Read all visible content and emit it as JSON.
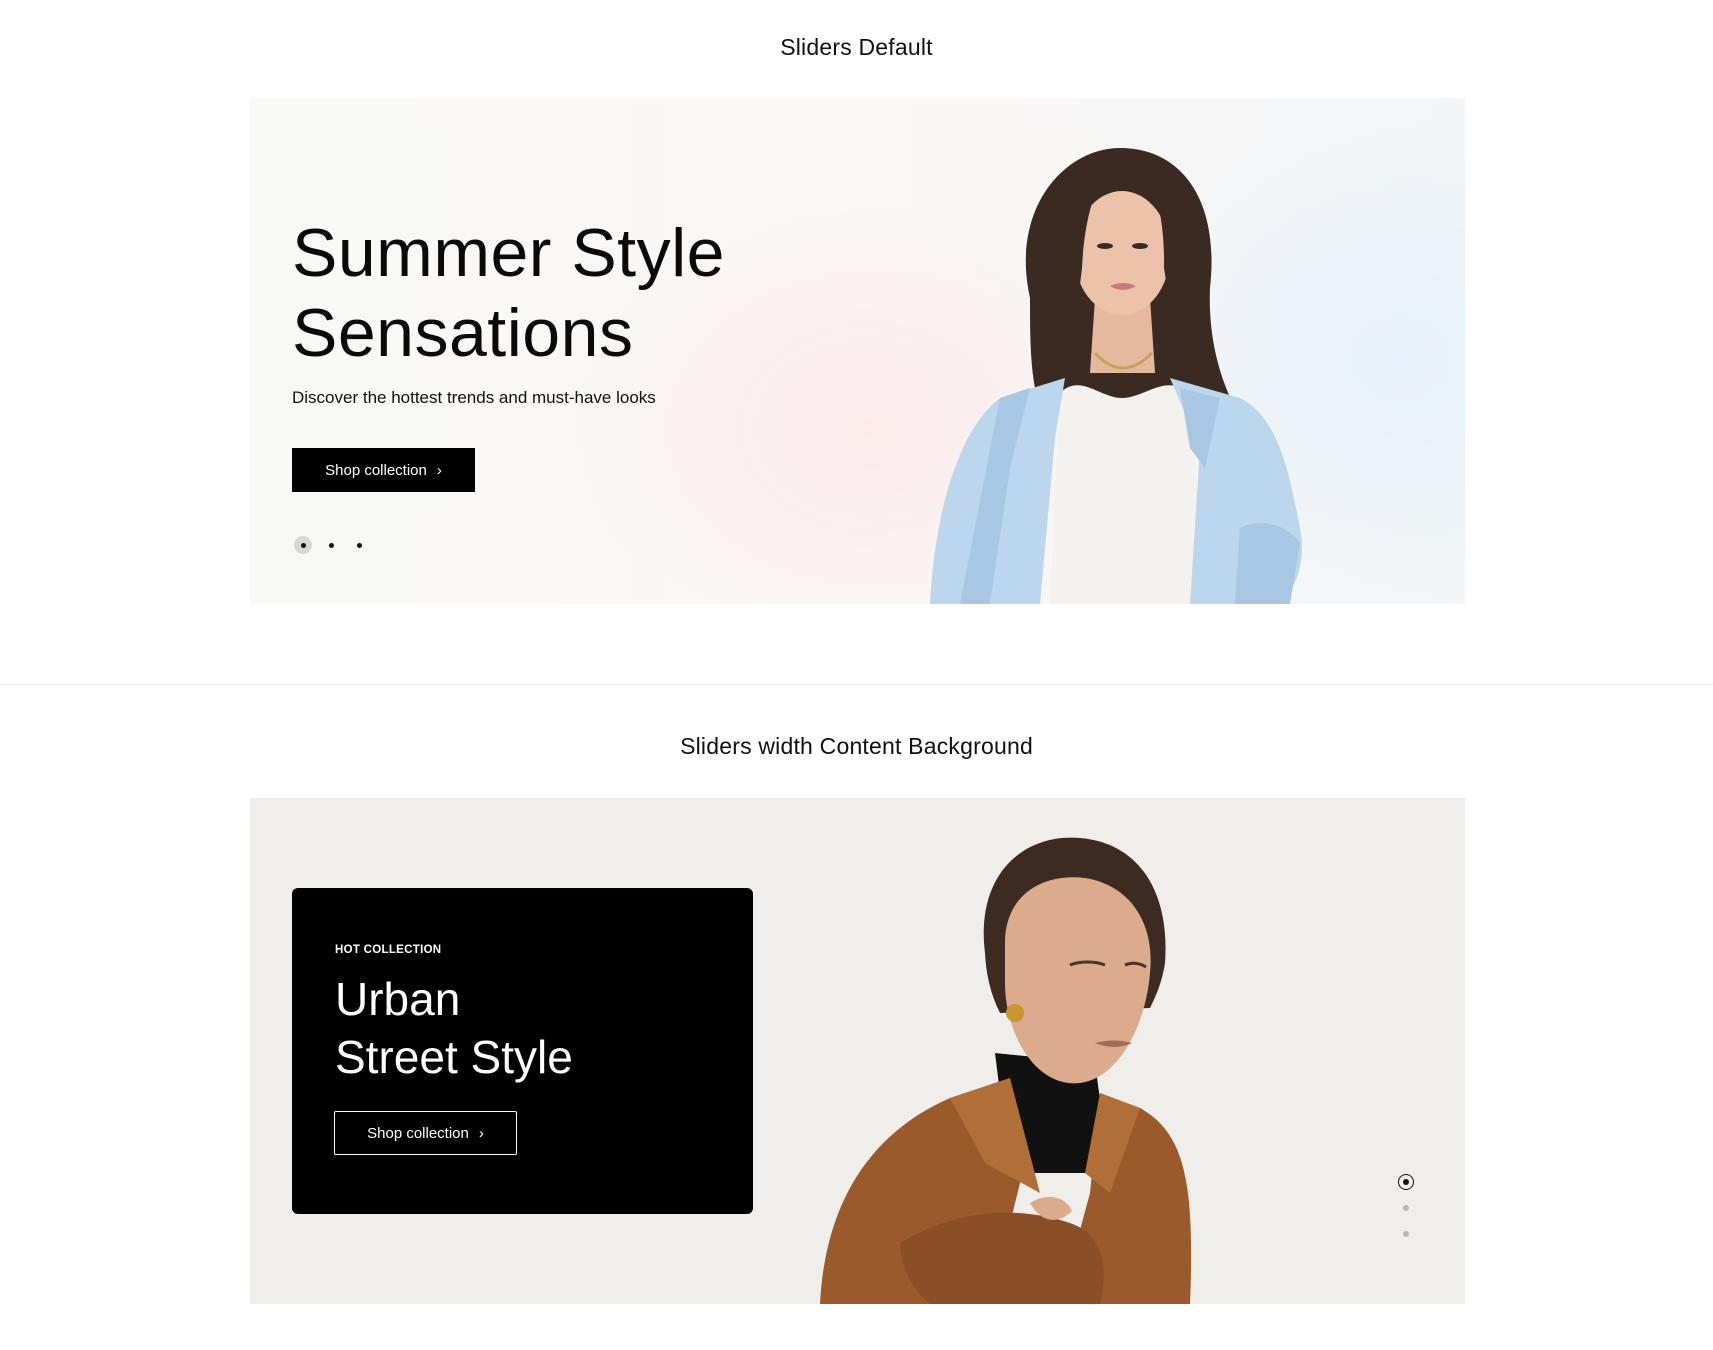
{
  "sections": [
    {
      "title": "Sliders Default",
      "slide": {
        "heading_line1": "Summer Style",
        "heading_line2": "Sensations",
        "subtitle": "Discover the hottest trends and must-have looks",
        "button_label": "Shop collection",
        "button_icon": "chevron-right-icon",
        "pagination": {
          "count": 3,
          "active_index": 0
        }
      }
    },
    {
      "title": "Sliders width Content Background",
      "slide": {
        "tag": "HOT COLLECTION",
        "heading_line1": "Urban",
        "heading_line2": "Street Style",
        "button_label": "Shop collection",
        "button_icon": "chevron-right-icon",
        "pagination": {
          "count": 3,
          "active_index": 0
        }
      }
    }
  ],
  "colors": {
    "button_dark": "#000000",
    "slide2_background": "#efeeeb",
    "card_background": "#000000",
    "blazer_blue": "#bcd6ee",
    "leather_brown": "#9a5a2c"
  }
}
